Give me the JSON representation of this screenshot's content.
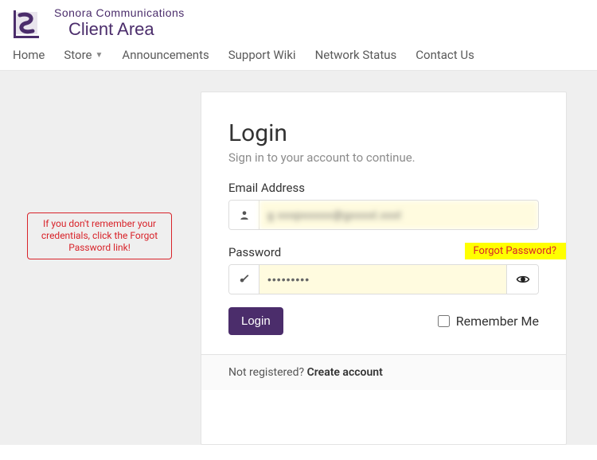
{
  "brand": {
    "line1": "Sonora Communications",
    "line2": "Client Area"
  },
  "nav": {
    "home": "Home",
    "store": "Store",
    "announcements": "Announcements",
    "support_wiki": "Support Wiki",
    "network_status": "Network Status",
    "contact": "Contact Us"
  },
  "annotation": {
    "text": "If you don't remember your credentials, click the Forgot Password link!"
  },
  "login": {
    "title": "Login",
    "subtitle": "Sign in to your account to continue.",
    "email_label": "Email Address",
    "email_value": "g xxxpxxxxx@gxxxxl.xxxl",
    "password_label": "Password",
    "password_value": "•••••••••",
    "forgot": "Forgot Password?",
    "login_button": "Login",
    "remember_label": "Remember Me",
    "footer_prefix": "Not registered? ",
    "footer_link": "Create account"
  },
  "colors": {
    "brand": "#4b2d6b",
    "danger": "#d8232a",
    "highlight": "#ffff00",
    "autofill": "#fffbdf"
  }
}
